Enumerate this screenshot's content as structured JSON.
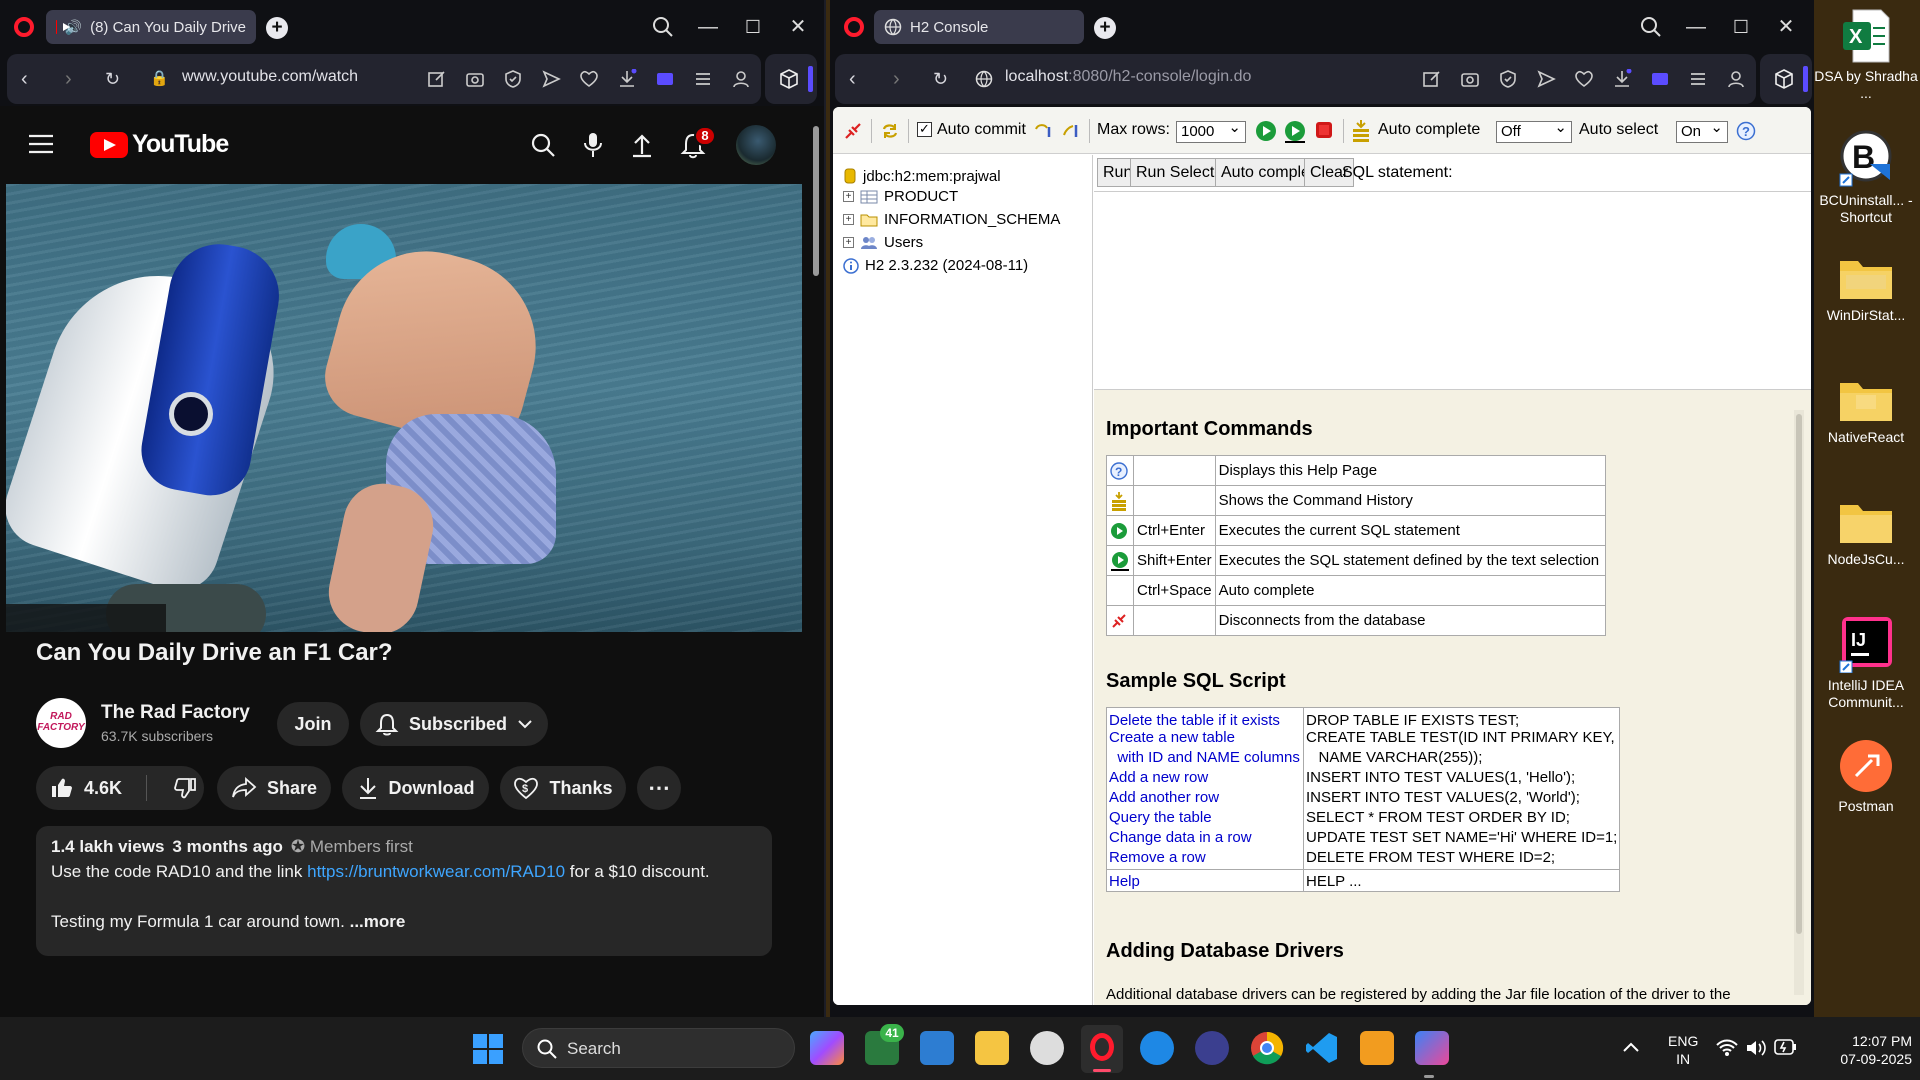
{
  "left_browser": {
    "tab_title": "(8) Can You Daily Drive",
    "url": "www.youtube.com/watch",
    "youtube": {
      "logo": "YouTube",
      "notif_count": "8",
      "video_title": "Can You Daily Drive an F1 Car?",
      "channel_name": "The Rad Factory",
      "channel_logo": "RAD FACTORY",
      "subscribers": "63.7K subscribers",
      "join_label": "Join",
      "subscribed_label": "Subscribed",
      "likes": "4.6K",
      "share_label": "Share",
      "download_label": "Download",
      "thanks_label": "Thanks",
      "views": "1.4 lakh views",
      "age": "3 months ago",
      "members_first": "Members first",
      "desc_line1_a": "Use the code RAD10 and the link ",
      "desc_link": "https://bruntworkwear.com/RAD10",
      "desc_line1_b": " for a $10 discount.",
      "desc_line2": "Testing my Formula 1 car around town.",
      "more_label": "...more"
    }
  },
  "right_browser": {
    "tab_title": "H2 Console",
    "url_host": "localhost",
    "url_rest": ":8080/h2-console/login.do",
    "h2": {
      "auto_commit_label": "Auto commit",
      "max_rows_label": "Max rows:",
      "max_rows_value": "1000",
      "auto_complete_label": "Auto complete",
      "auto_complete_value": "Off",
      "auto_select_label": "Auto select",
      "auto_select_value": "On",
      "tree": {
        "db": "jdbc:h2:mem:prajwal",
        "items": [
          "PRODUCT",
          "INFORMATION_SCHEMA",
          "Users"
        ],
        "version": "H2 2.3.232 (2024-08-11)"
      },
      "buttons": {
        "run": "Run",
        "run_selected": "Run Selected",
        "auto_complete": "Auto complete",
        "clear": "Clear"
      },
      "sql_statement_label": "SQL statement:",
      "important_commands_title": "Important Commands",
      "commands": [
        {
          "icon": "help-icon",
          "key": "",
          "desc": "Displays this Help Page"
        },
        {
          "icon": "history-icon",
          "key": "",
          "desc": "Shows the Command History"
        },
        {
          "icon": "run-icon",
          "key": "Ctrl+Enter",
          "desc": "Executes the current SQL statement"
        },
        {
          "icon": "run-selected-icon",
          "key": "Shift+Enter",
          "desc": "Executes the SQL statement defined by the text selection"
        },
        {
          "icon": "",
          "key": "Ctrl+Space",
          "desc": "Auto complete"
        },
        {
          "icon": "disconnect-icon",
          "key": "",
          "desc": "Disconnects from the database"
        }
      ],
      "sample_sql_title": "Sample SQL Script",
      "script": [
        {
          "label": "Delete the table if it exists",
          "sql": "DROP TABLE IF EXISTS TEST;"
        },
        {
          "label": "Create a new table",
          "sql": "CREATE TABLE TEST(ID INT PRIMARY KEY,"
        },
        {
          "label": "  with ID and NAME columns",
          "sql": "   NAME VARCHAR(255));"
        },
        {
          "label": "Add a new row",
          "sql": "INSERT INTO TEST VALUES(1, 'Hello');"
        },
        {
          "label": "Add another row",
          "sql": "INSERT INTO TEST VALUES(2, 'World');"
        },
        {
          "label": "Query the table",
          "sql": "SELECT * FROM TEST ORDER BY ID;"
        },
        {
          "label": "Change data in a row",
          "sql": "UPDATE TEST SET NAME='Hi' WHERE ID=1;"
        },
        {
          "label": "Remove a row",
          "sql": "DELETE FROM TEST WHERE ID=2;"
        }
      ],
      "help_row": {
        "label": "Help",
        "sql": "HELP ..."
      },
      "adding_drivers_title": "Adding Database Drivers",
      "drivers_text": "Additional database drivers can be registered by adding the Jar file location of the driver to the"
    }
  },
  "desktop_icons": [
    {
      "label": "DSA by Shradha ...",
      "icon": "excel-icon"
    },
    {
      "label": "BCUninstall... - Shortcut",
      "icon": "bcuninstaller-icon"
    },
    {
      "label": "WinDirStat...",
      "icon": "folder-icon"
    },
    {
      "label": "NativeReact",
      "icon": "folder-icon"
    },
    {
      "label": "NodeJsCu...",
      "icon": "folder-icon"
    },
    {
      "label": "IntelliJ IDEA Communit...",
      "icon": "intellij-icon"
    },
    {
      "label": "Postman",
      "icon": "postman-icon"
    }
  ],
  "taskbar": {
    "search_label": "Search",
    "badge_count": "41",
    "lang_line1": "ENG",
    "lang_line2": "IN",
    "time": "12:07 PM",
    "date": "07-09-2025"
  }
}
